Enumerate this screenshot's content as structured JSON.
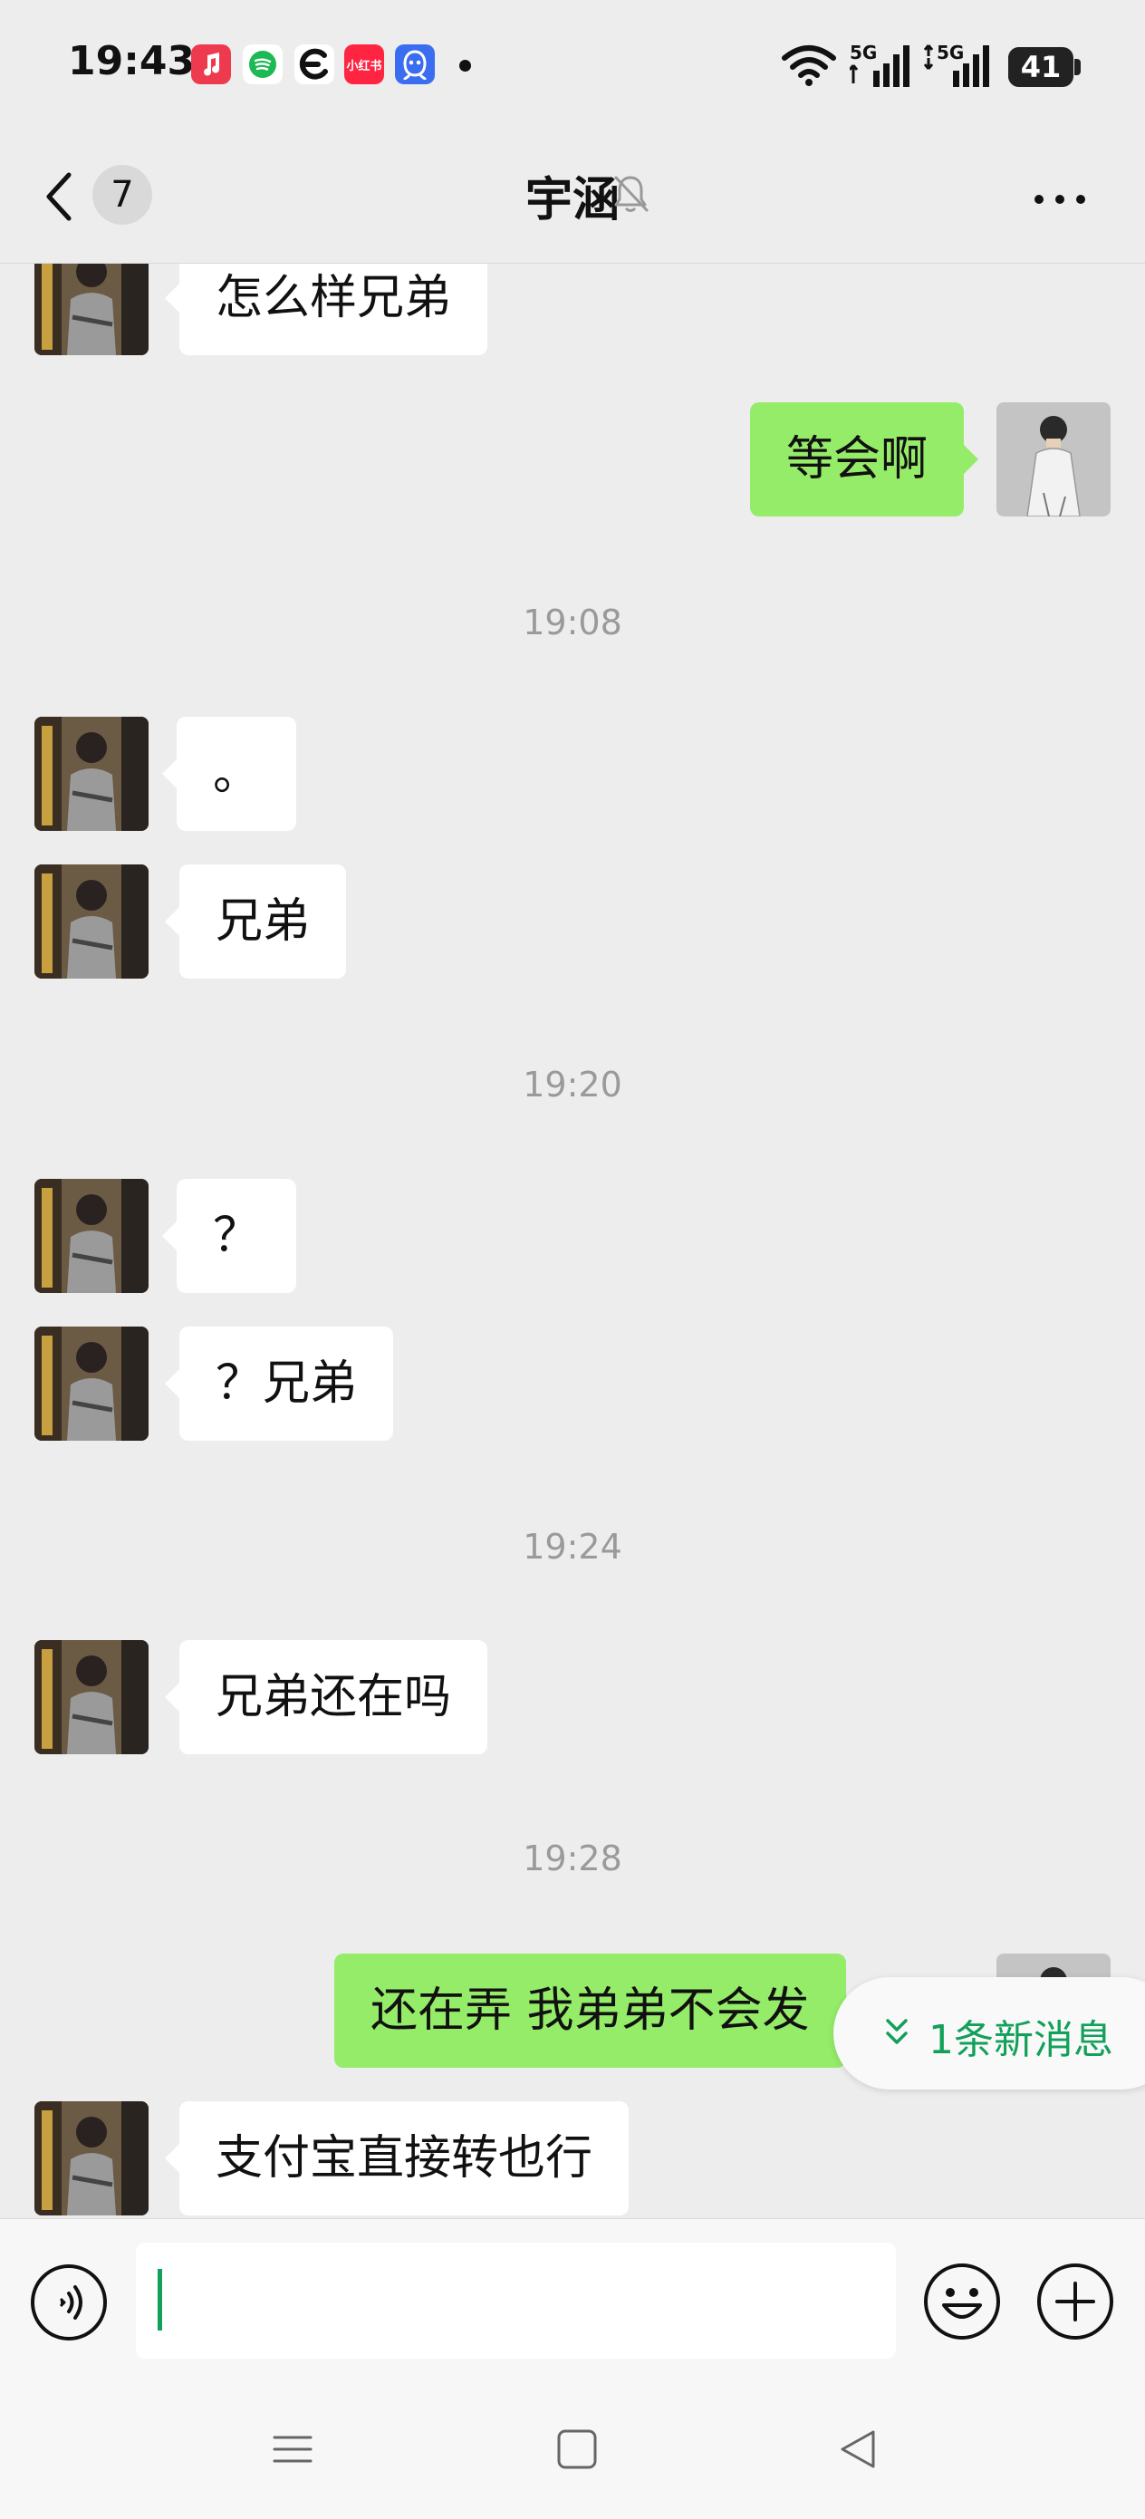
{
  "status_bar": {
    "time": "19:43",
    "battery": "41",
    "battery_level": 0.41,
    "network1": "5G",
    "network2": "5G",
    "app_icons": [
      "music-icon",
      "spotify-icon",
      "browser-e-icon",
      "xiaohongshu-icon",
      "qq-icon"
    ],
    "xiaohongshu_text": "小红书"
  },
  "header": {
    "unread_count": "7",
    "title": "宇涵"
  },
  "messages": [
    {
      "type": "in",
      "text": "怎么样兄弟"
    },
    {
      "type": "out",
      "text": "等会啊"
    },
    {
      "type": "time",
      "text": "19:08"
    },
    {
      "type": "in",
      "text": "。"
    },
    {
      "type": "in",
      "text": "兄弟"
    },
    {
      "type": "time",
      "text": "19:20"
    },
    {
      "type": "in",
      "text": "？"
    },
    {
      "type": "in",
      "text": "？兄弟"
    },
    {
      "type": "time",
      "text": "19:24"
    },
    {
      "type": "in",
      "text": "兄弟还在吗"
    },
    {
      "type": "time",
      "text": "19:28"
    },
    {
      "type": "out",
      "text": "还在弄  我弟弟不会发"
    },
    {
      "type": "in",
      "text": "支付宝直接转也行"
    }
  ],
  "new_message_indicator": "1条新消息",
  "input": {
    "value": ""
  },
  "colors": {
    "background": "#ededed",
    "outgoing_bubble": "#95ec69",
    "incoming_bubble": "#ffffff",
    "accent_green": "#12a05a"
  }
}
